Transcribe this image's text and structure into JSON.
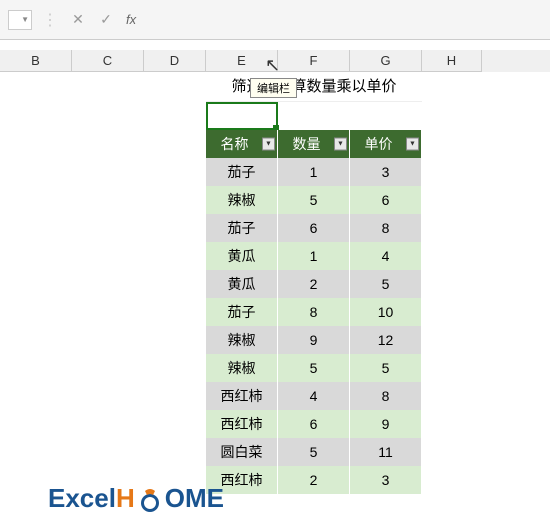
{
  "formula_bar": {
    "fx_label": "fx",
    "cancel_icon": "✕",
    "confirm_icon": "✓"
  },
  "tooltip": "编辑栏",
  "columns": [
    "B",
    "C",
    "D",
    "E",
    "F",
    "G",
    "H"
  ],
  "title": "筛选后计算数量乘以单价",
  "table": {
    "headers": [
      "名称",
      "数量",
      "单价"
    ],
    "rows": [
      {
        "name": "茄子",
        "qty": "1",
        "price": "3",
        "shade": "grey"
      },
      {
        "name": "辣椒",
        "qty": "5",
        "price": "6",
        "shade": "green"
      },
      {
        "name": "茄子",
        "qty": "6",
        "price": "8",
        "shade": "grey"
      },
      {
        "name": "黄瓜",
        "qty": "1",
        "price": "4",
        "shade": "green"
      },
      {
        "name": "黄瓜",
        "qty": "2",
        "price": "5",
        "shade": "grey"
      },
      {
        "name": "茄子",
        "qty": "8",
        "price": "10",
        "shade": "green"
      },
      {
        "name": "辣椒",
        "qty": "9",
        "price": "12",
        "shade": "grey"
      },
      {
        "name": "辣椒",
        "qty": "5",
        "price": "5",
        "shade": "green"
      },
      {
        "name": "西红柿",
        "qty": "4",
        "price": "8",
        "shade": "grey"
      },
      {
        "name": "西红柿",
        "qty": "6",
        "price": "9",
        "shade": "green"
      },
      {
        "name": "圆白菜",
        "qty": "5",
        "price": "11",
        "shade": "grey"
      },
      {
        "name": "西红柿",
        "qty": "2",
        "price": "3",
        "shade": "green"
      }
    ]
  },
  "logo": {
    "excel": "Excel",
    "h": "H",
    "ome": "OME"
  }
}
